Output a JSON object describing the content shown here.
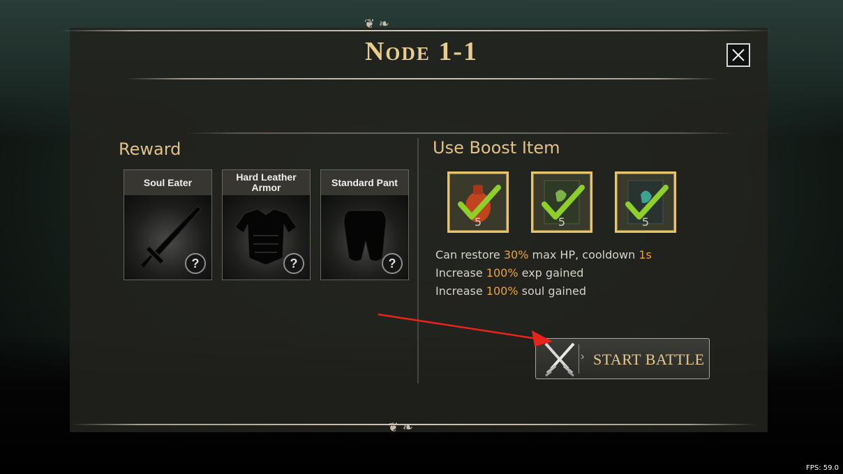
{
  "title": "Node 1-1",
  "reward": {
    "title": "Reward",
    "items": [
      {
        "name": "Soul Eater",
        "icon": "sword-icon"
      },
      {
        "name": "Hard Leather Armor",
        "icon": "armor-icon"
      },
      {
        "name": "Standard Pant",
        "icon": "pants-icon"
      }
    ],
    "unknown_mark": "?"
  },
  "boost": {
    "title": "Use Boost Item",
    "items": [
      {
        "icon": "hp-potion-icon",
        "count": "5",
        "selected": true,
        "color": "#c0441e"
      },
      {
        "icon": "exp-scroll-icon",
        "count": "5",
        "selected": true,
        "color": "#7cb24a"
      },
      {
        "icon": "soul-scroll-icon",
        "count": "5",
        "selected": true,
        "color": "#3aa48e"
      }
    ],
    "descriptions": [
      {
        "pre": "Can restore ",
        "hl": "30%",
        "mid": " max HP, cooldown ",
        "hl2": "1s"
      },
      {
        "pre": "Increase ",
        "hl": "100%",
        "mid": " exp gained"
      },
      {
        "pre": "Increase ",
        "hl": "100%",
        "mid": " soul gained"
      }
    ]
  },
  "start_button": {
    "label": "START BATTLE",
    "icon": "crossed-swords-icon"
  },
  "close_icon": "close-icon",
  "fps": "FPS: 59.0",
  "colors": {
    "gold": "#e8cd8c",
    "highlight": "#e8a43c",
    "check": "#8ecf2a"
  }
}
